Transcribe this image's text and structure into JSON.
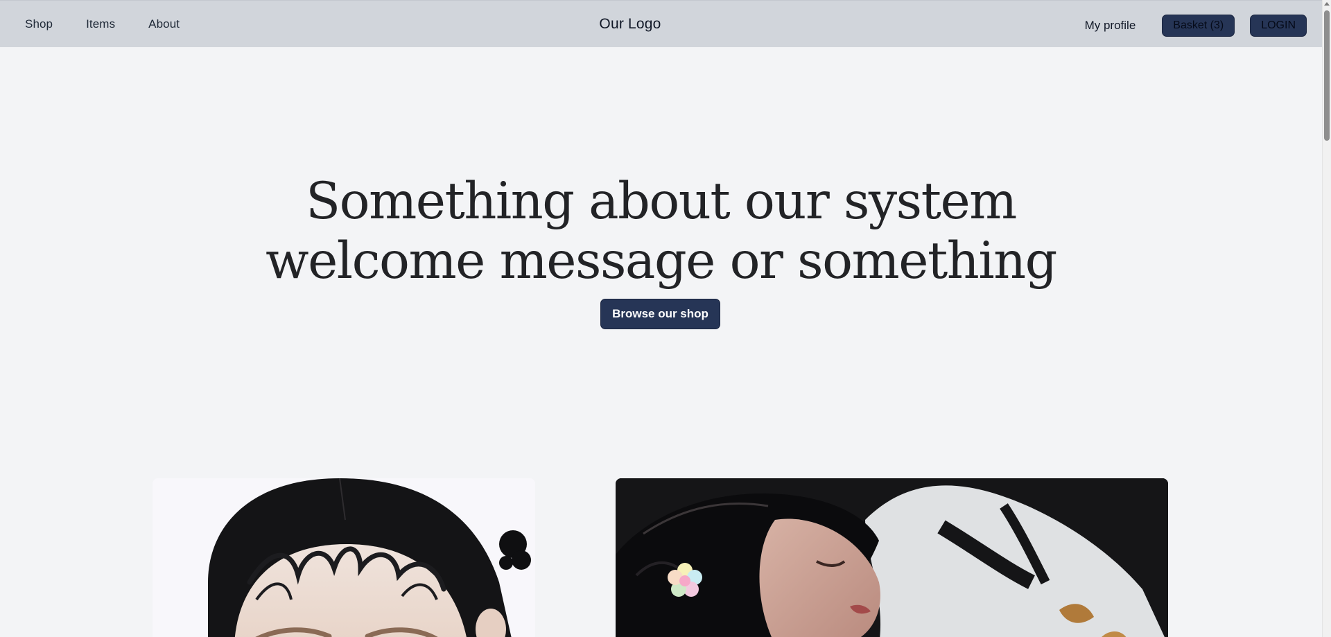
{
  "nav": {
    "links": [
      {
        "label": "Shop"
      },
      {
        "label": "Items"
      },
      {
        "label": "About"
      }
    ],
    "logo": "Our Logo",
    "profile_label": "My profile",
    "basket_label": "Basket (3)",
    "login_label": "LOGIN"
  },
  "hero": {
    "title_line1": "Something about our system",
    "title_line2": "welcome message or something",
    "cta_label": "Browse our shop"
  },
  "features": [
    {
      "image": "portrait-photo-light"
    },
    {
      "image": "portrait-photo-dark"
    }
  ],
  "colors": {
    "page_bg": "#f3f4f6",
    "nav_bg": "#d1d5db",
    "button_bg": "#263556",
    "heading_text": "#222326"
  }
}
